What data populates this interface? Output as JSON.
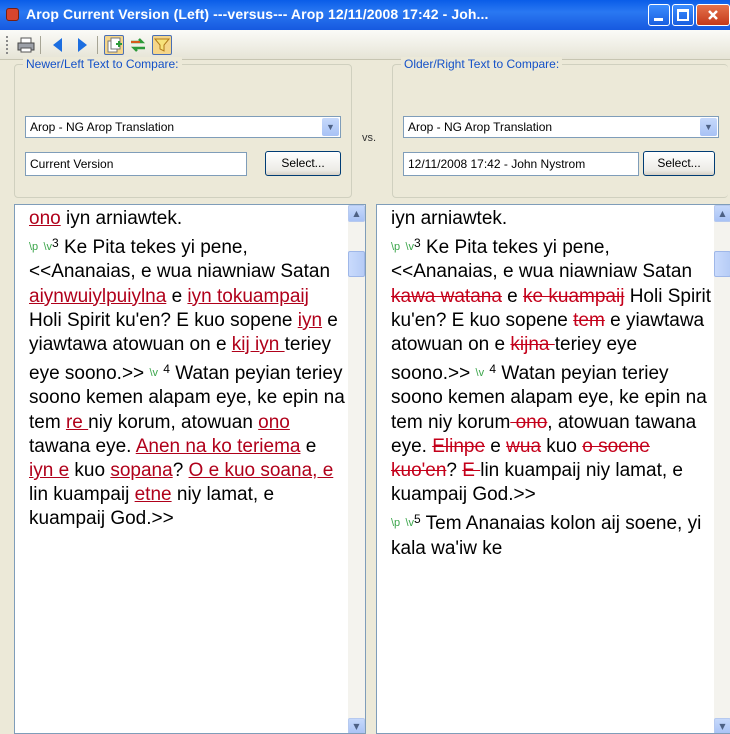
{
  "window": {
    "title": "Arop Current Version (Left) ---versus--- Arop 12/11/2008 17:42 - Joh..."
  },
  "toolbar": {
    "icons": [
      "print-icon",
      "previous-arrow-icon",
      "next-arrow-icon",
      "add-files-icon",
      "swap-icon",
      "filter-icon"
    ]
  },
  "left_panel": {
    "group_label": "Newer/Left Text to Compare:",
    "project": "Arop - NG Arop Translation",
    "version": "Current Version",
    "select_label": "Select..."
  },
  "vs_label": "vs.",
  "right_panel": {
    "group_label": "Older/Right Text to Compare:",
    "project": "Arop - NG Arop Translation",
    "version": "12/11/2008 17:42 - John Nystrom",
    "select_label": "Select..."
  },
  "left_text": [
    [
      [
        "i",
        "ono"
      ],
      [
        "t",
        " iyn arniawtek."
      ]
    ],
    [
      [
        "t",
        "  "
      ],
      [
        "m",
        "\\p"
      ],
      [
        "t",
        " "
      ],
      [
        "m",
        "\\v"
      ],
      [
        "v",
        "3"
      ],
      [
        "t",
        " Ke Pita tekes yi pene, <<Ananaias, e wua niawniaw Satan "
      ],
      [
        "i",
        "aiynwuiylpuiylna"
      ],
      [
        "t",
        " e "
      ],
      [
        "i",
        "iyn tokuampaij"
      ],
      [
        "t",
        " Holi Spirit ku'en? E kuo sopene "
      ],
      [
        "i",
        "iyn"
      ],
      [
        "t",
        " e yiawtawa atowuan on e "
      ],
      [
        "i",
        "kij iyn "
      ],
      [
        "t",
        "teriey eye soono.>> "
      ],
      [
        "m",
        "\\v"
      ],
      [
        "t",
        " "
      ],
      [
        "v",
        "4"
      ],
      [
        "t",
        " Watan peyian teriey soono kemen alapam eye, ke epin na tem "
      ],
      [
        "i",
        "re "
      ],
      [
        "t",
        "niy korum, atowuan "
      ],
      [
        "i",
        "ono "
      ],
      [
        "t",
        "tawana eye. "
      ],
      [
        "i",
        "Anen na ko teriema"
      ],
      [
        "t",
        " e "
      ],
      [
        "i",
        "iyn e"
      ],
      [
        "t",
        " kuo "
      ],
      [
        "i",
        "sopana"
      ],
      [
        "t",
        "? "
      ],
      [
        "i",
        "O e kuo soana, e "
      ],
      [
        "t",
        "lin kuampaij "
      ],
      [
        "i",
        "etne"
      ],
      [
        "t",
        " niy lamat, e kuampaij God.>>"
      ]
    ]
  ],
  "right_text": [
    [
      [
        "t",
        "iyn arniawtek."
      ]
    ],
    [
      [
        "t",
        "  "
      ],
      [
        "m",
        "\\p"
      ],
      [
        "t",
        " "
      ],
      [
        "m",
        "\\v"
      ],
      [
        "v",
        "3"
      ],
      [
        "t",
        " Ke Pita tekes yi pene, <<Ananaias, e wua niawniaw Satan "
      ],
      [
        "d",
        "kawa watana"
      ],
      [
        "t",
        " e "
      ],
      [
        "d",
        "ke kuampaij"
      ],
      [
        "t",
        " Holi Spirit ku'en? E kuo sopene "
      ],
      [
        "d",
        "tem"
      ],
      [
        "t",
        " e yiawtawa atowuan on e "
      ],
      [
        "d",
        "kijna "
      ],
      [
        "t",
        "teriey eye soono.>> "
      ],
      [
        "m",
        "\\v"
      ],
      [
        "t",
        " "
      ],
      [
        "v",
        "4"
      ],
      [
        "t",
        " Watan peyian teriey soono kemen alapam eye, ke epin na tem niy korum"
      ],
      [
        "d",
        " ono"
      ],
      [
        "t",
        ", atowuan tawana eye. "
      ],
      [
        "d",
        "Elinpe"
      ],
      [
        "t",
        " e "
      ],
      [
        "d",
        "wua"
      ],
      [
        "t",
        " kuo "
      ],
      [
        "d",
        "o soene kuo'en"
      ],
      [
        "t",
        "? "
      ],
      [
        "d",
        "E "
      ],
      [
        "t",
        "lin kuampaij niy lamat, e kuampaij God.>>"
      ]
    ],
    [
      [
        "t",
        "  "
      ],
      [
        "m",
        "\\p"
      ],
      [
        "t",
        " "
      ],
      [
        "m",
        "\\v"
      ],
      [
        "v",
        "5"
      ],
      [
        "t",
        " Tem Ananaias kolon aij soene, yi kala wa'iw ke"
      ]
    ]
  ],
  "colors": {
    "titlebar": "#0a5de8",
    "inserted_text": "#b0001a",
    "deleted_text": "#c4001a",
    "marker": "#3aa54a",
    "group_label": "#1451c8"
  }
}
